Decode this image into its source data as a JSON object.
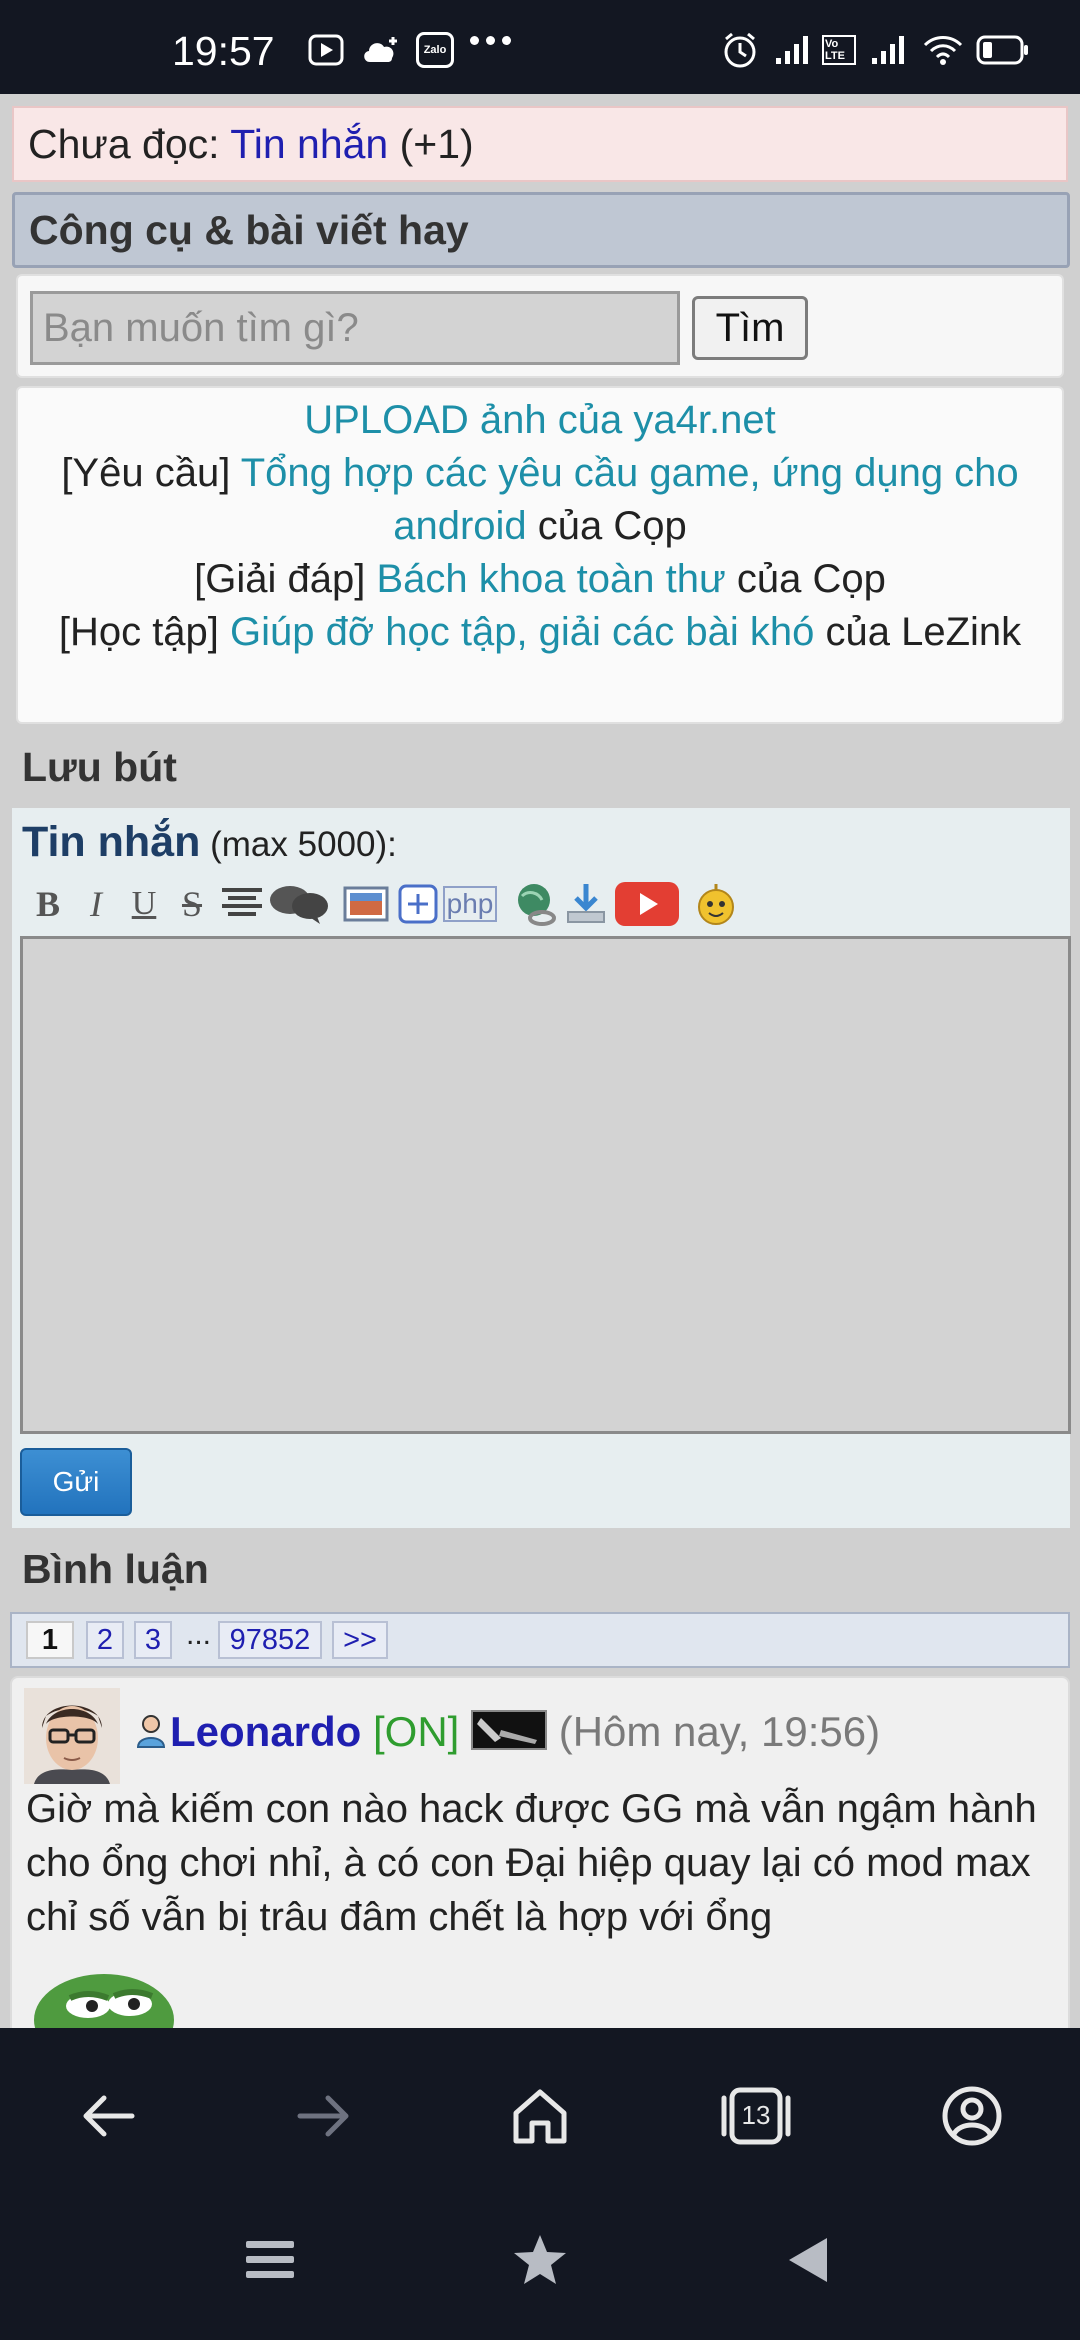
{
  "status_bar": {
    "time": "19:57",
    "icons": [
      "play-store-icon",
      "cloud-icon",
      "zalo-icon",
      "more-dots-icon",
      "alarm-icon",
      "signal-icon",
      "volte-icon",
      "signal-icon",
      "wifi-icon",
      "battery-icon"
    ],
    "zalo_label": "Zalo",
    "volte_label": "Vo LTE"
  },
  "unread": {
    "prefix": "Chưa đọc: ",
    "link": "Tin nhắn",
    "count": " (+1)"
  },
  "tools_section": {
    "title": "Công cụ & bài viết hay"
  },
  "search": {
    "placeholder": "Bạn muốn tìm gì?",
    "button": "Tìm"
  },
  "links": {
    "upload": "UPLOAD ảnh của ya4r.net",
    "line2_prefix": "[Yêu cầu] ",
    "line2_link": "Tổng hợp các yêu cầu game, ứng dụng cho android",
    "line2_suffix": " của Cọp",
    "line3_prefix": "[Giải đáp] ",
    "line3_link": "Bách khoa toàn thư",
    "line3_suffix": " của Cọp",
    "line4_prefix": "[Học tập] ",
    "line4_link": "Giúp đỡ học tập, giải các bài khó",
    "line4_suffix": " của LeZink"
  },
  "guestbook": {
    "title": "Lưu bút",
    "message_label": "Tin nhắn",
    "max_label": " (max 5000):",
    "toolbar": [
      "bold",
      "italic",
      "underline",
      "strike",
      "align",
      "quote",
      "image",
      "plus",
      "php",
      "link",
      "download",
      "youtube",
      "smiley"
    ],
    "toolbar_labels": {
      "bold": "B",
      "italic": "I",
      "underline": "U",
      "strike": "S",
      "php": "php"
    },
    "send": "Gửi"
  },
  "comments": {
    "title": "Bình luận",
    "pages": [
      "1",
      "2",
      "3",
      "97852",
      ">>"
    ],
    "ellipsis": "...",
    "items": [
      {
        "user": "Leonardo",
        "status": "[ON]",
        "time": "(Hôm nay, 19:56)",
        "text": "Giờ mà kiếm con nào hack được GG mà vẫn ngậm hành cho ổng chơi nhỉ, à có con Đại hiệp quay lại có mod max chỉ số vẫn bị trâu đâm chết là hợp với ổng"
      }
    ]
  },
  "browser_nav": {
    "tabs_count": "13",
    "buttons": [
      "back-icon",
      "forward-icon",
      "home-icon",
      "tabs-icon",
      "account-icon"
    ]
  },
  "system_nav": {
    "buttons": [
      "menu-icon",
      "bookmark-star-icon",
      "system-back-icon"
    ]
  }
}
